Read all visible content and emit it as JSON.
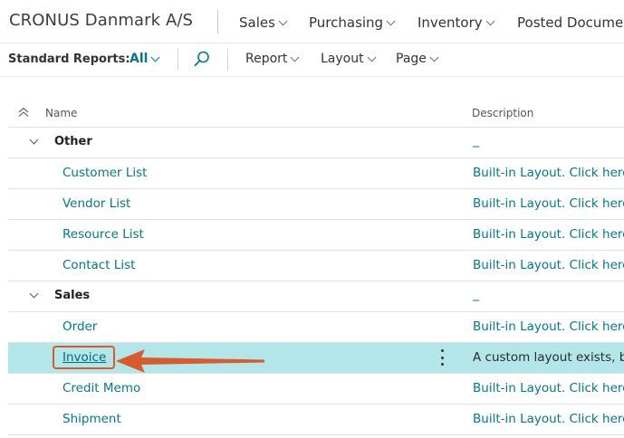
{
  "app": {
    "company": "CRONUS Danmark A/S",
    "nav": [
      {
        "label": "Sales"
      },
      {
        "label": "Purchasing"
      },
      {
        "label": "Inventory"
      },
      {
        "label": "Posted Documen"
      }
    ]
  },
  "toolbar": {
    "title": "Standard Reports:",
    "filter": "All",
    "menus": [
      "Report",
      "Layout",
      "Page"
    ]
  },
  "table": {
    "columns": {
      "name": "Name",
      "description": "Description"
    },
    "groups": [
      {
        "name": "Other",
        "description": "_",
        "items": [
          {
            "name": "Customer List",
            "description": "Built-in Layout. Click here to"
          },
          {
            "name": "Vendor List",
            "description": "Built-in Layout. Click here to"
          },
          {
            "name": "Resource List",
            "description": "Built-in Layout. Click here to"
          },
          {
            "name": "Contact List",
            "description": "Built-in Layout. Click here to"
          }
        ]
      },
      {
        "name": "Sales",
        "description": "_",
        "items": [
          {
            "name": "Order",
            "description": "Built-in Layout. Click here to"
          },
          {
            "name": "Invoice",
            "description": "A custom layout exists, but",
            "selected": true
          },
          {
            "name": "Credit Memo",
            "description": "Built-in Layout. Click here to"
          },
          {
            "name": "Shipment",
            "description": "Built-in Layout. Click here to"
          }
        ]
      }
    ]
  },
  "colors": {
    "accent": "#00798a",
    "selected_row": "#b2e6e9",
    "callout": "#d95b2c"
  },
  "icons": {
    "search": "search-icon",
    "collapse_all": "collapse-all-icon",
    "row_menu": "more-vertical-icon",
    "callout": "arrow-left-icon"
  }
}
